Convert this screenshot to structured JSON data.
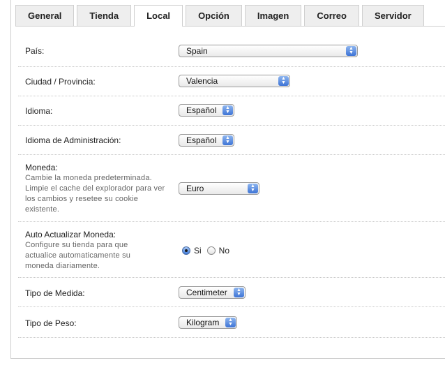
{
  "tabs": [
    {
      "label": "General",
      "active": false
    },
    {
      "label": "Tienda",
      "active": false
    },
    {
      "label": "Local",
      "active": true
    },
    {
      "label": "Opción",
      "active": false
    },
    {
      "label": "Imagen",
      "active": false
    },
    {
      "label": "Correo",
      "active": false
    },
    {
      "label": "Servidor",
      "active": false
    }
  ],
  "form": {
    "pais": {
      "label": "País:",
      "value": "Spain"
    },
    "ciudad": {
      "label": "Ciudad / Provincia:",
      "value": "Valencia"
    },
    "idioma": {
      "label": "Idioma:",
      "value": "Español"
    },
    "idioma_admin": {
      "label": "Idioma de Administración:",
      "value": "Español"
    },
    "moneda": {
      "label": "Moneda:",
      "description": "Cambie la moneda predeterminada. Limpie el cache del explorador para ver los cambios y resetee su cookie existente.",
      "value": "Euro"
    },
    "auto_moneda": {
      "label": "Auto Actualizar Moneda:",
      "description": "Configure su tienda para que actualice automaticamente su moneda diariamente.",
      "option_yes": "Si",
      "option_no": "No",
      "selected": "Si"
    },
    "medida": {
      "label": "Tipo de Medida:",
      "value": "Centimeter"
    },
    "peso": {
      "label": "Tipo de Peso:",
      "value": "Kilogram"
    }
  },
  "colors": {
    "accent": "#3d74d6",
    "border": "#cfcfcf",
    "tab_bg": "#eeeeee"
  }
}
